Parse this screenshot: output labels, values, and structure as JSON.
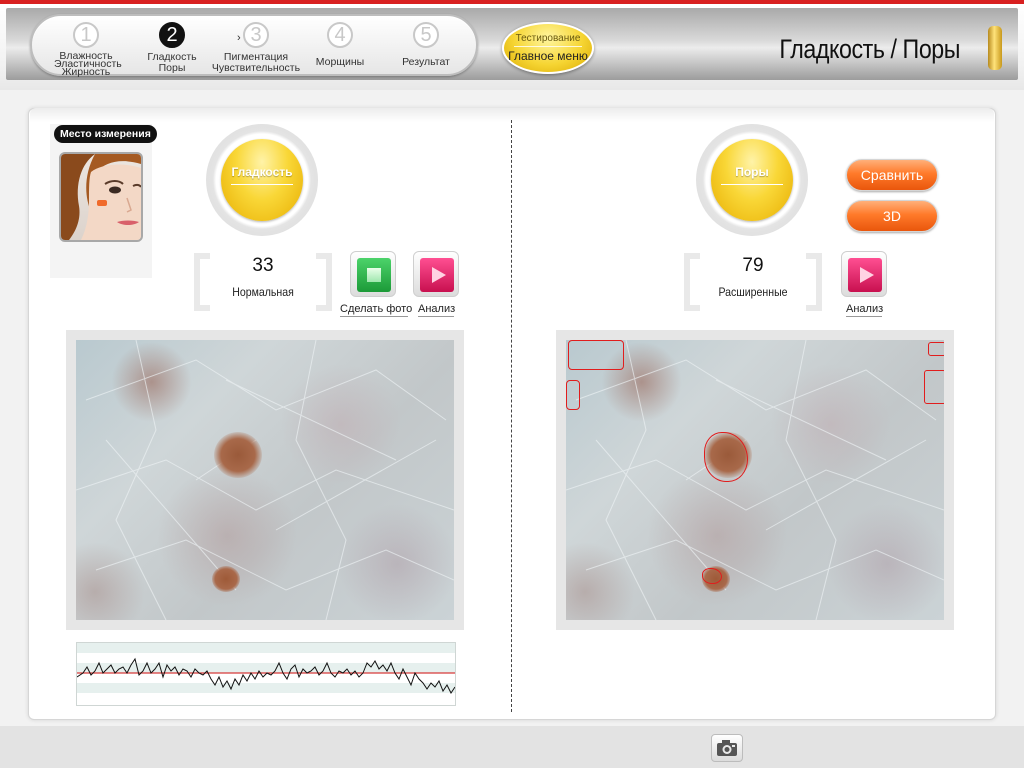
{
  "steps": [
    {
      "num": "1",
      "lines": [
        "Влажность",
        "Эластичность",
        "Жирность"
      ]
    },
    {
      "num": "2",
      "lines": [
        "Гладкость",
        "Поры"
      ]
    },
    {
      "num": "3",
      "lines": [
        "Пигментация",
        "Чувствительность"
      ]
    },
    {
      "num": "4",
      "lines": [
        "Морщины"
      ]
    },
    {
      "num": "5",
      "lines": [
        "Результат"
      ]
    }
  ],
  "step_arrow": "›",
  "test_button": {
    "top": "Тестирование",
    "bottom": "Главное меню"
  },
  "page_title": "Гладкость / Поры",
  "measure_label": "Место измерения",
  "left": {
    "orb_label": "Гладкость",
    "value": "33",
    "class_label": "Нормальная",
    "photo_button": "Сделать фото",
    "analyze_button": "Анализ"
  },
  "right": {
    "orb_label": "Поры",
    "value": "79",
    "class_label": "Расширенные",
    "analyze_button": "Анализ",
    "compare_button": "Сравнить",
    "threed_button": "3D"
  },
  "colors": {
    "accent_red": "#d82020",
    "orb_gold": "#f6cf2f",
    "photo_green": "#2db34a",
    "analyze_pink": "#e0185f",
    "orange": "#ff7a2a",
    "outline_red": "#e11d1d"
  },
  "icons": {
    "photo": "camera-shutter-icon",
    "analyze": "play-triangle-icon",
    "footer": "camera-icon"
  }
}
